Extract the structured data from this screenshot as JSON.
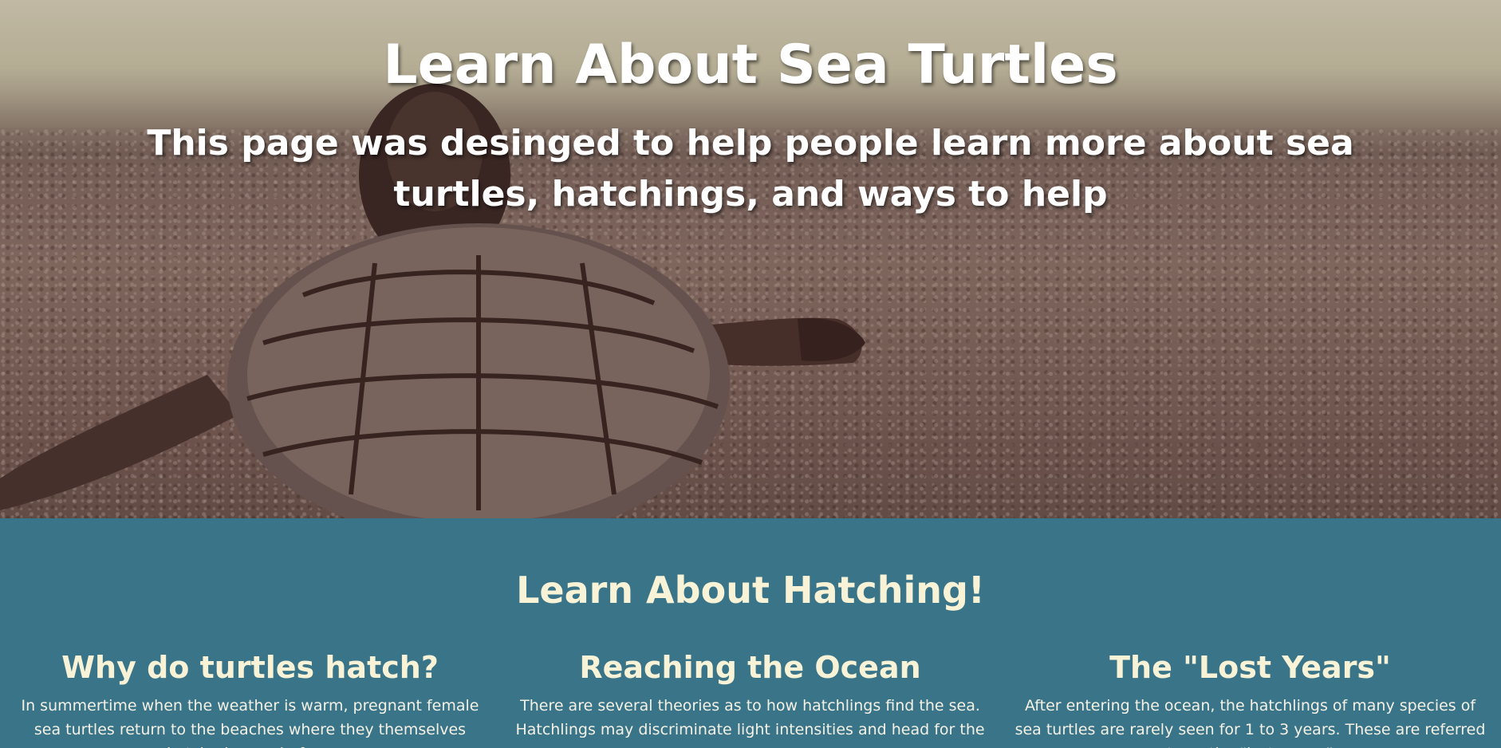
{
  "hero": {
    "title": "Learn About Sea Turtles",
    "subtitle": "This page was desinged to help people learn more about sea turtles, hatchings, and ways to help",
    "image_subject": "sea-turtle-hatchling-on-sand"
  },
  "hatching": {
    "title": "Learn About Hatching!",
    "columns": [
      {
        "heading": "Why do turtles hatch?",
        "text": "In summertime when the weather is warm, pregnant female sea turtles return to the beaches where they themselves hatched years before."
      },
      {
        "heading": "Reaching the Ocean",
        "text": "There are several theories as to how hatchlings find the sea. Hatchlings may discriminate light intensities and head for the"
      },
      {
        "heading": "The \"Lost Years\"",
        "text": "After entering the ocean, the hatchlings of many species of sea turtles are rarely seen for 1 to 3 years. These are referred to as the “lost years.”"
      }
    ]
  },
  "colors": {
    "section_bg": "#3a7489",
    "heading_text": "#f8f3d6",
    "hero_text": "#ffffff"
  }
}
